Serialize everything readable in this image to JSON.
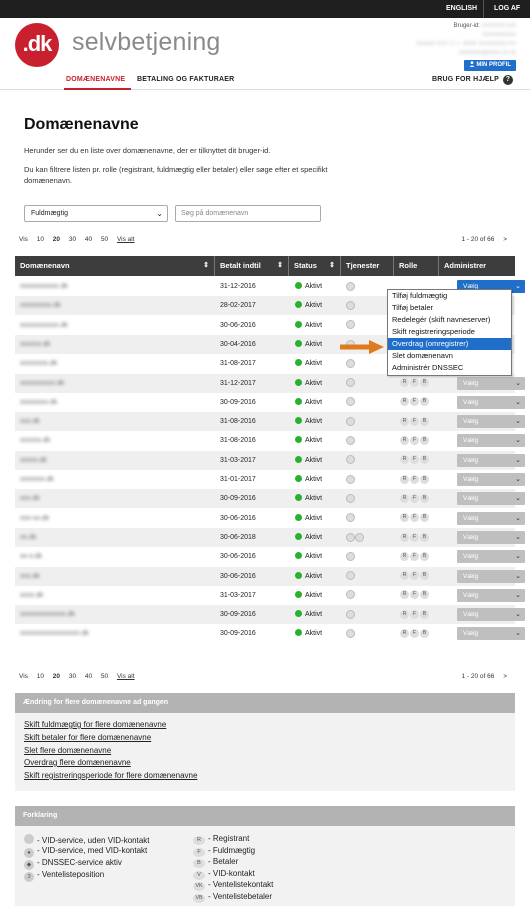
{
  "topbar": {
    "english": "ENGLISH",
    "logout": "LOG AF"
  },
  "brand": {
    "logo": ".dk",
    "name": "selvbetjening"
  },
  "user": {
    "id_label": "Bruger-id:",
    "id_value": "XXXXXX-DK",
    "line1": "Xxxxxxxxxxx",
    "line2": "Xxxxxx XXX 177, 4000 Xxxxxxxxx XX",
    "line3": "xxxxxxxx@xxxx.xx.xx",
    "profile_button": "MIN PROFIL"
  },
  "nav": {
    "tab1": "DOMÆNENAVNE",
    "tab2": "BETALING OG FAKTURAER",
    "help": "BRUG FOR HJÆLP",
    "help_icon": "?"
  },
  "page": {
    "title": "Domænenavne",
    "intro1": "Herunder ser du en liste over domænenavne, der er tilknyttet dit bruger-id.",
    "intro2": "Du kan filtrere listen pr. rolle (registrant, fuldmægtig eller betaler) eller søge efter et specifikt domænenavn."
  },
  "filter": {
    "role_value": "Fuldmægtig",
    "search_placeholder": "Søg på domænenavn"
  },
  "pager": {
    "vis": "Vis",
    "opts": [
      "10",
      "20",
      "30",
      "40",
      "50",
      "Vis alt"
    ],
    "range": "1 - 20 of 66",
    "next": ">"
  },
  "pager_bottom": {
    "range": "1 - 20 of 66",
    "next": ">"
  },
  "table": {
    "headers": [
      "Domænenavn",
      "Betalt indtil",
      "Status",
      "Tjenester",
      "Rolle",
      "Administrer"
    ],
    "status_text": "Aktivt",
    "roles": [
      "R",
      "F",
      "B"
    ],
    "select_label": "Vælg",
    "rows": [
      {
        "domain": "xxxxxxxxxxx.dk",
        "date": "31-12-2016"
      },
      {
        "domain": "xxxxxxxxx.dk",
        "date": "28-02-2017"
      },
      {
        "domain": "xxxxxxxxxxx.dk",
        "date": "30-06-2016"
      },
      {
        "domain": "xxxxxx.dk",
        "date": "30-04-2016"
      },
      {
        "domain": "xxxxxxxx.dk",
        "date": "31-08-2017"
      },
      {
        "domain": "xxxxxxxxxx.dk",
        "date": "31-12-2017"
      },
      {
        "domain": "xxxxxxxx.dk",
        "date": "30-09-2016"
      },
      {
        "domain": "xxx.dk",
        "date": "31-08-2016"
      },
      {
        "domain": "xxxxxx.dk",
        "date": "31-08-2016"
      },
      {
        "domain": "xxxxx.dk",
        "date": "31-03-2017"
      },
      {
        "domain": "xxxxxxx.dk",
        "date": "31-01-2017"
      },
      {
        "domain": "xxx.dk",
        "date": "30-09-2016"
      },
      {
        "domain": "xxx-xx.dk",
        "date": "30-06-2016"
      },
      {
        "domain": "xx.dk",
        "date": "30-06-2018"
      },
      {
        "domain": "xx-x.dk",
        "date": "30-06-2016"
      },
      {
        "domain": "xxx.dk",
        "date": "30-06-2016"
      },
      {
        "domain": "xxxx.dk",
        "date": "31-03-2017"
      },
      {
        "domain": "xxxxxxxxxxxxx.dk",
        "date": "30-09-2016"
      },
      {
        "domain": "xxxxxxxxxxxxxxxxx.dk",
        "date": "30-09-2016"
      }
    ]
  },
  "dropdown": {
    "items": [
      "Tilføj fuldmægtig",
      "Tilføj betaler",
      "Redelegér (skift navneserver)",
      "Skift registreringsperiode",
      "Overdrag (omregistrer)",
      "Slet domænenavn",
      "Administrér DNSSEC"
    ]
  },
  "bulk": {
    "title": "Ændring for flere domænenavne ad gangen",
    "links": [
      "Skift fuldmægtig for flere domænenavne",
      "Skift betaler for flere domænenavne",
      "Slet flere domænenavne",
      "Overdrag flere domænenavne",
      "Skift registreringsperiode for flere domænenavne"
    ]
  },
  "legend": {
    "title": "Forklaring",
    "left": [
      "- VID-service, uden VID-kontakt",
      "- VID-service, med VID-kontakt",
      "- DNSSEC-service aktiv",
      "- Ventelisteposition"
    ],
    "right_codes": [
      "R",
      "F",
      "B",
      "V",
      "VK",
      "VB"
    ],
    "right": [
      "- Registrant",
      "- Fuldmægtig",
      "- Betaler",
      "- VID-kontakt",
      "- Ventelistekontakt",
      "- Ventelistebetaler"
    ]
  },
  "colors": {
    "brand_red": "#c8202f",
    "active_green": "#2bb02b",
    "select_blue": "#1f6ec9",
    "arrow_orange": "#e07a1f"
  }
}
